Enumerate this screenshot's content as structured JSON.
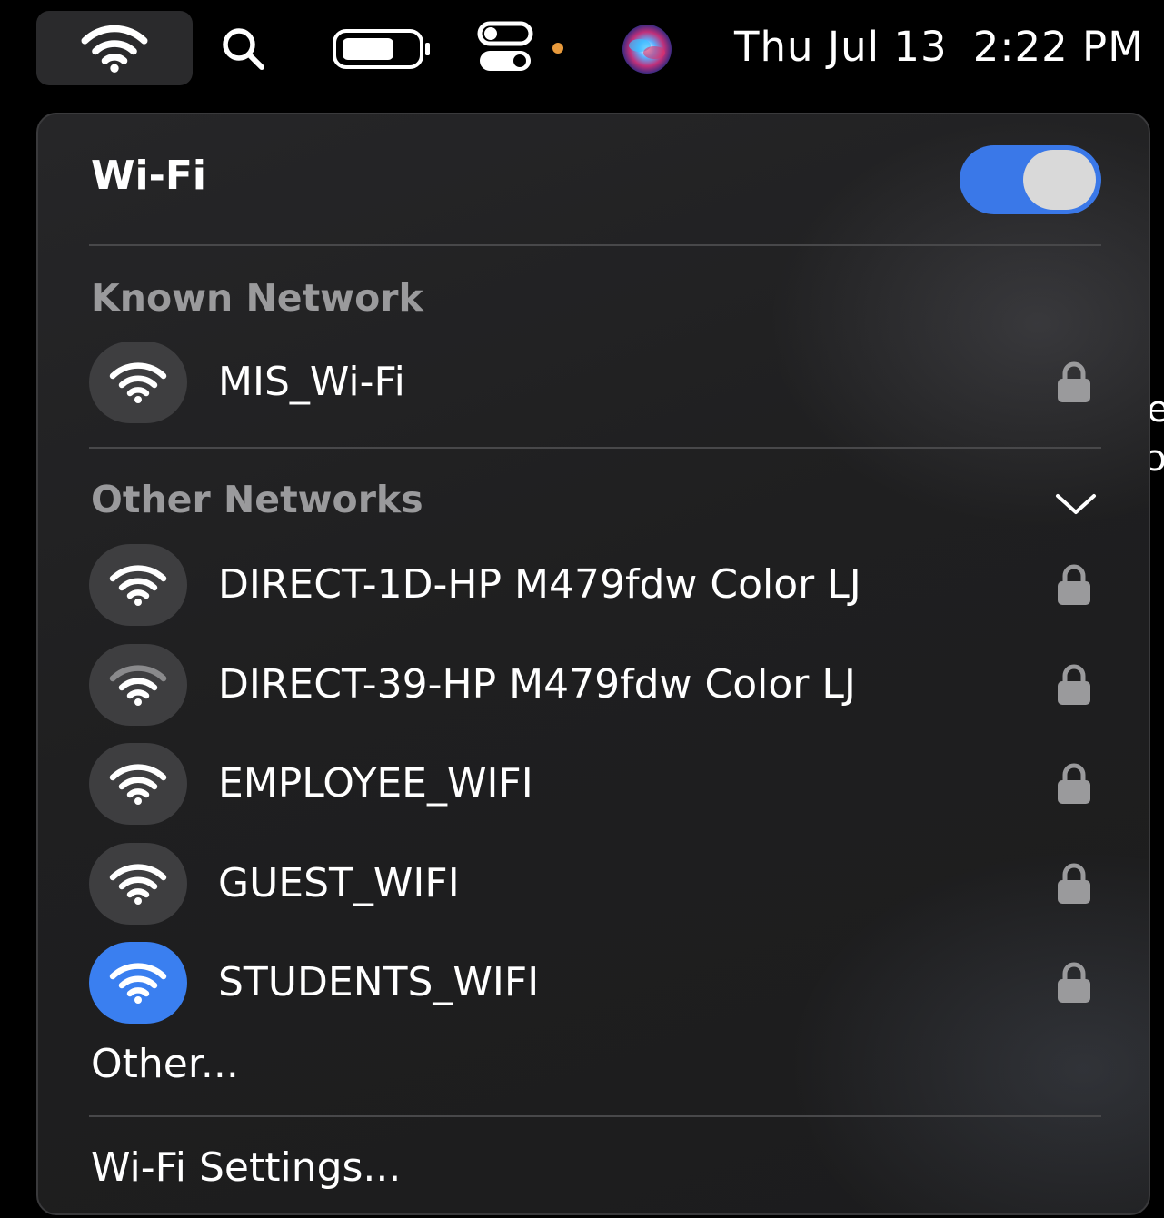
{
  "menubar": {
    "icons": [
      "wifi-icon",
      "search-icon",
      "battery-icon",
      "control-center-icon",
      "siri-icon"
    ],
    "clock": {
      "date": "Thu Jul 13",
      "time": "2:22 PM"
    }
  },
  "wifi_panel": {
    "title": "Wi-Fi",
    "enabled": true,
    "known_header": "Known Network",
    "known_networks": [
      {
        "name": "MIS_Wi-Fi",
        "locked": true,
        "signal": "full",
        "connected": false
      }
    ],
    "other_header": "Other Networks",
    "other_networks": [
      {
        "name": "DIRECT-1D-HP M479fdw Color LJ",
        "locked": true,
        "signal": "full",
        "connected": false
      },
      {
        "name": "DIRECT-39-HP M479fdw Color LJ",
        "locked": true,
        "signal": "weak",
        "connected": false
      },
      {
        "name": "EMPLOYEE_WIFI",
        "locked": true,
        "signal": "full",
        "connected": false
      },
      {
        "name": "GUEST_WIFI",
        "locked": true,
        "signal": "full",
        "connected": false
      },
      {
        "name": "STUDENTS_WIFI",
        "locked": true,
        "signal": "full",
        "connected": true
      }
    ],
    "other_item": "Other...",
    "settings_item": "Wi-Fi Settings..."
  },
  "colors": {
    "accent": "#3a7ff0",
    "toggle_on": "#3a78e8",
    "panel_bg": "#1f1f20",
    "header_text": "#9a9a9c"
  }
}
